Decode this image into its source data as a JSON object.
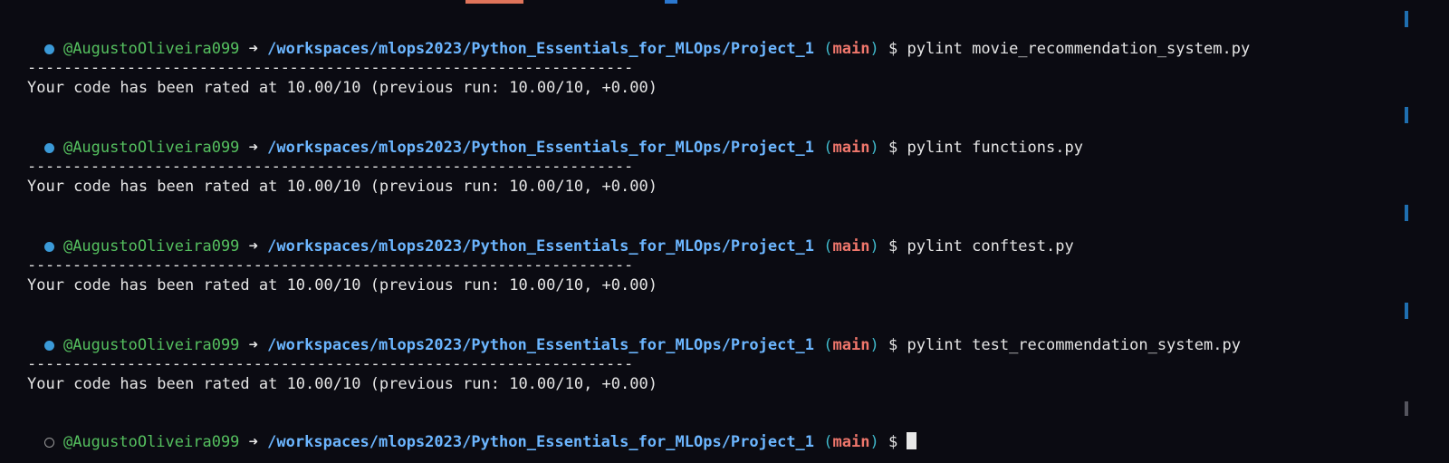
{
  "terminal": {
    "user": "@AugustoOliveira099",
    "arrow": "➜",
    "path": "/workspaces/mlops2023/Python_Essentials_for_MLOps/Project_1",
    "paren_open": "(",
    "branch": "main",
    "paren_close": ")",
    "dollar": "$",
    "separator": "-------------------------------------------------------------------",
    "blocks": [
      {
        "command": "pylint movie_recommendation_system.py",
        "result": "Your code has been rated at 10.00/10 (previous run: 10.00/10, +0.00)"
      },
      {
        "command": "pylint functions.py",
        "result": "Your code has been rated at 10.00/10 (previous run: 10.00/10, +0.00)"
      },
      {
        "command": "pylint conftest.py",
        "result": "Your code has been rated at 10.00/10 (previous run: 10.00/10, +0.00)"
      },
      {
        "command": "pylint test_recommendation_system.py",
        "result": "Your code has been rated at 10.00/10 (previous run: 10.00/10, +0.00)"
      }
    ],
    "final_command": ""
  }
}
